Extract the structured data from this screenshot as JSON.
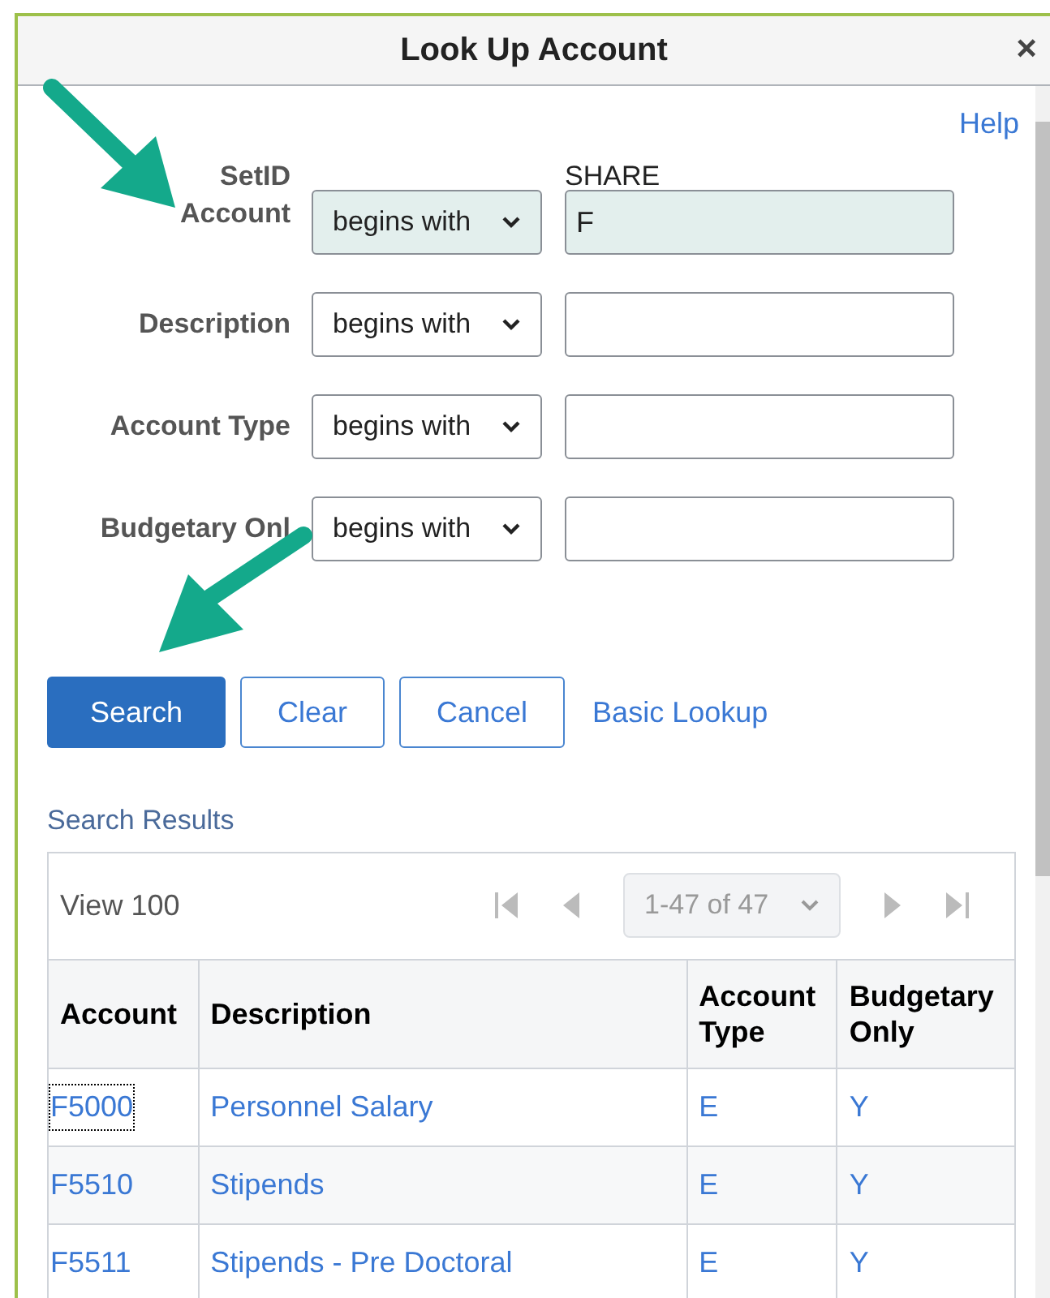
{
  "dialog": {
    "title": "Look Up Account",
    "close": "×"
  },
  "help_link": "Help",
  "setid": {
    "label": "SetID",
    "value": "SHARE"
  },
  "criteria": [
    {
      "label": "Account",
      "operator": "begins with",
      "value": "F",
      "highlighted": true
    },
    {
      "label": "Description",
      "operator": "begins with",
      "highlighted": false
    },
    {
      "label": "Account Type",
      "operator": "begins with",
      "highlighted": false
    },
    {
      "label": "Budgetary Onl",
      "operator": "begins with",
      "highlighted": false
    }
  ],
  "buttons": [
    {
      "label": "Search",
      "kind": "primary"
    },
    {
      "label": "Clear",
      "kind": "secondary"
    },
    {
      "label": "Cancel",
      "kind": "secondary"
    },
    {
      "label": "Basic Lookup",
      "kind": "link"
    }
  ],
  "results": {
    "title": "Search Results",
    "view": "View 100",
    "pager": "1-47 of 47",
    "columns": [
      "Account",
      "Description",
      "Account Type",
      "Budgetary Only"
    ],
    "rows": [
      {
        "cells": [
          "F5000",
          "Personnel Salary",
          "E",
          "Y"
        ],
        "focused": true
      },
      {
        "cells": [
          "F5510",
          "Stipends",
          "E",
          "Y"
        ],
        "focused": false
      },
      {
        "cells": [
          "F5511",
          "Stipends - Pre Doctoral",
          "E",
          "Y"
        ],
        "focused": false
      }
    ]
  }
}
